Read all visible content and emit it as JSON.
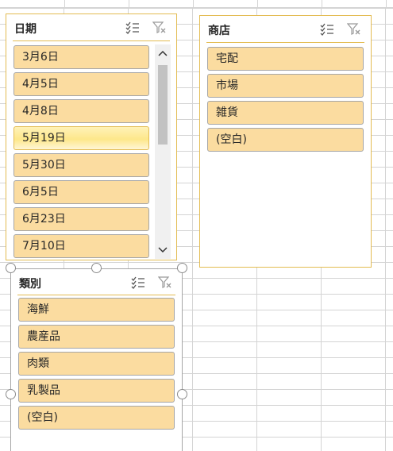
{
  "slicers": {
    "date": {
      "title": "日期",
      "items": [
        {
          "label": "3月6日"
        },
        {
          "label": "4月5日"
        },
        {
          "label": "4月8日"
        },
        {
          "label": "5月19日"
        },
        {
          "label": "5月30日"
        },
        {
          "label": "6月5日"
        },
        {
          "label": "6月23日"
        },
        {
          "label": "7月10日"
        }
      ]
    },
    "store": {
      "title": "商店",
      "items": [
        {
          "label": "宅配"
        },
        {
          "label": "市場"
        },
        {
          "label": "雑貨"
        },
        {
          "label": "(空白)"
        }
      ]
    },
    "category": {
      "title": "類別",
      "items": [
        {
          "label": "海鮮"
        },
        {
          "label": "農産品"
        },
        {
          "label": "肉類"
        },
        {
          "label": "乳製品"
        },
        {
          "label": "(空白)"
        }
      ]
    }
  },
  "colors": {
    "slicer_border": "#e3bc52",
    "item_fill": "#fbdca0",
    "item_hover": "#fde78a",
    "grid": "#d4d4d4"
  },
  "icons": {
    "multi_select": "multi-select-icon",
    "clear_filter": "clear-filter-icon",
    "scroll_up": "chevron-up-icon",
    "scroll_down": "chevron-down-icon"
  }
}
